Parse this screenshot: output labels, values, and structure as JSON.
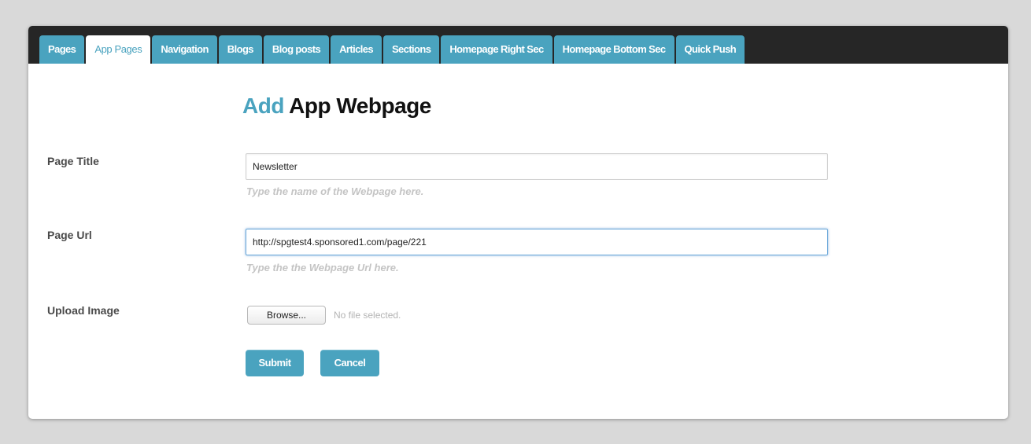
{
  "tabs": [
    {
      "label": "Pages",
      "active": false
    },
    {
      "label": "App Pages",
      "active": true
    },
    {
      "label": "Navigation",
      "active": false
    },
    {
      "label": "Blogs",
      "active": false
    },
    {
      "label": "Blog posts",
      "active": false
    },
    {
      "label": "Articles",
      "active": false
    },
    {
      "label": "Sections",
      "active": false
    },
    {
      "label": "Homepage Right Sec",
      "active": false
    },
    {
      "label": "Homepage Bottom Sec",
      "active": false
    },
    {
      "label": "Quick Push",
      "active": false
    }
  ],
  "heading": {
    "accent": "Add",
    "rest": " App Webpage"
  },
  "form": {
    "page_title": {
      "label": "Page Title",
      "value": "Newsletter",
      "hint": "Type the name of the Webpage here."
    },
    "page_url": {
      "label": "Page Url",
      "value": "http://spgtest4.sponsored1.com/page/221",
      "hint": "Type the the Webpage Url here."
    },
    "upload_image": {
      "label": "Upload Image",
      "browse_label": "Browse...",
      "file_status": "No file selected."
    },
    "submit_label": "Submit",
    "cancel_label": "Cancel"
  },
  "colors": {
    "accent": "#4aa3bf",
    "tabbar_background": "#262626",
    "page_background": "#d9d9d9",
    "hint_text": "#c4c4c4"
  }
}
